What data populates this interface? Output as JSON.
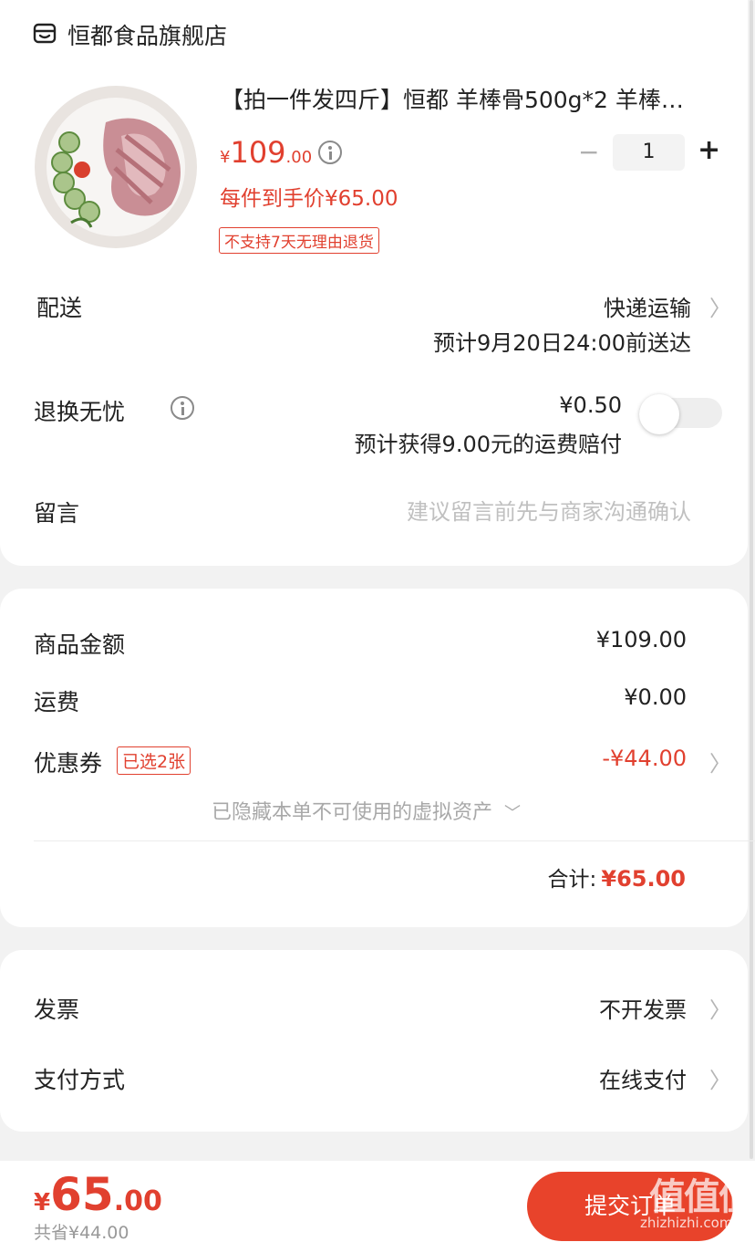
{
  "store": {
    "icon": "store-icon",
    "name": "恒都食品旗舰店"
  },
  "product": {
    "image": "lamb-shank-image",
    "title": "【拍一件发四斤】恒都  羊棒骨500g*2 羊棒…",
    "price_symbol": "¥",
    "price_int": "109",
    "price_dec": ".00",
    "final_price": "每件到手价¥65.00",
    "tag": "不支持7天无理由退货",
    "quantity": "1",
    "minus": "−",
    "plus": "+"
  },
  "delivery": {
    "label": "配送",
    "method": "快递运输",
    "eta": "预计9月20日24:00前送达"
  },
  "return_insurance": {
    "label": "退换无忧",
    "price": "¥0.50",
    "desc": "预计获得9.00元的运费赔付",
    "enabled": false
  },
  "message": {
    "label": "留言",
    "placeholder": "建议留言前先与商家沟通确认"
  },
  "summary": {
    "goods_label": "商品金额",
    "goods_value": "¥109.00",
    "shipping_label": "运费",
    "shipping_value": "¥0.00",
    "coupon_label": "优惠券",
    "coupon_badge": "已选2张",
    "coupon_value": "-¥44.00",
    "hidden_assets": "已隐藏本单不可使用的虚拟资产",
    "total_label": "合计:",
    "total_value": "¥65.00"
  },
  "invoice": {
    "label": "发票",
    "value": "不开发票"
  },
  "payment": {
    "label": "支付方式",
    "value": "在线支付"
  },
  "footer": {
    "price_symbol": "¥",
    "price_int": "65",
    "price_dec": ".00",
    "saved": "共省¥44.00",
    "submit": "提交订单",
    "watermark_main": "值值值",
    "watermark_sub": "zhizhizhi.com"
  },
  "colors": {
    "accent": "#e1402f",
    "background": "#f2f2f2",
    "card": "#ffffff"
  }
}
